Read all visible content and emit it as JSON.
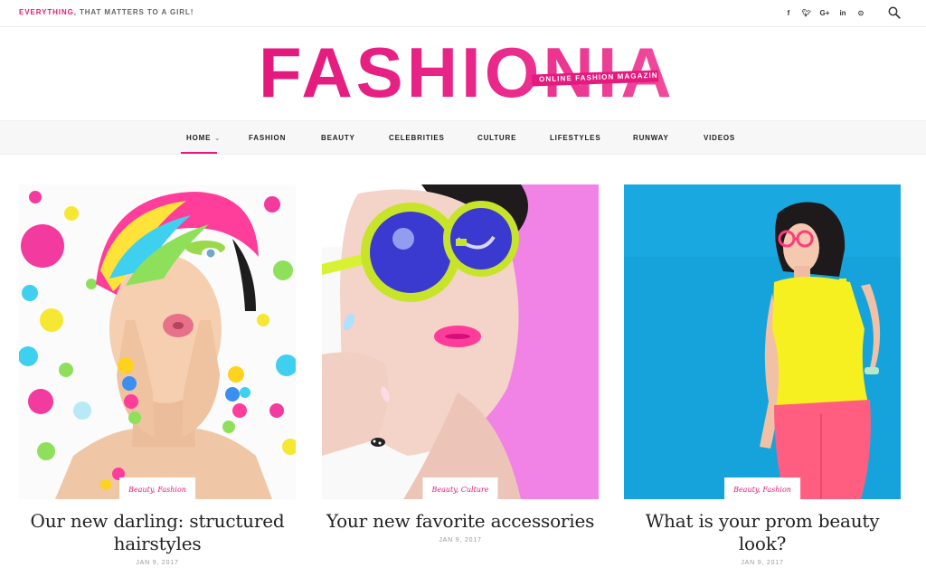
{
  "topbar": {
    "tagline_accent": "EVERYTHING",
    "tagline_rest": ", THAT MATTERS TO A GIRL!",
    "social": [
      {
        "icon": "facebook-icon",
        "glyph": "f"
      },
      {
        "icon": "twitter-icon",
        "glyph": "ᵛ"
      },
      {
        "icon": "google-plus-icon",
        "glyph": "G+"
      },
      {
        "icon": "linkedin-icon",
        "glyph": "in"
      },
      {
        "icon": "pinterest-icon",
        "glyph": "⊙"
      }
    ],
    "search_icon": "search-icon"
  },
  "logo": {
    "text": "FASHIONIA",
    "subtitle": "ONLINE FASHION MAGAZIN"
  },
  "nav": {
    "items": [
      {
        "label": "HOME",
        "active": true
      },
      {
        "label": "FASHION"
      },
      {
        "label": "BEAUTY"
      },
      {
        "label": "CELEBRITIES"
      },
      {
        "label": "CULTURE"
      },
      {
        "label": "LIFESTYLES"
      },
      {
        "label": "RUNWAY"
      },
      {
        "label": "VIDEOS"
      }
    ],
    "caret": "⌄"
  },
  "colors": {
    "accent": "#e6197e",
    "nav_background": "#f7f7f7"
  },
  "posts": [
    {
      "categories": "Beauty, Fashion",
      "title": "Our new darling: structured hairstyles",
      "date": "JAN 9, 2017"
    },
    {
      "categories": "Beauty, Culture",
      "title": "Your new favorite accessories",
      "date": "JAN 9, 2017"
    },
    {
      "categories": "Beauty, Fashion",
      "title": "What is your prom beauty look?",
      "date": "JAN 9, 2017"
    }
  ]
}
